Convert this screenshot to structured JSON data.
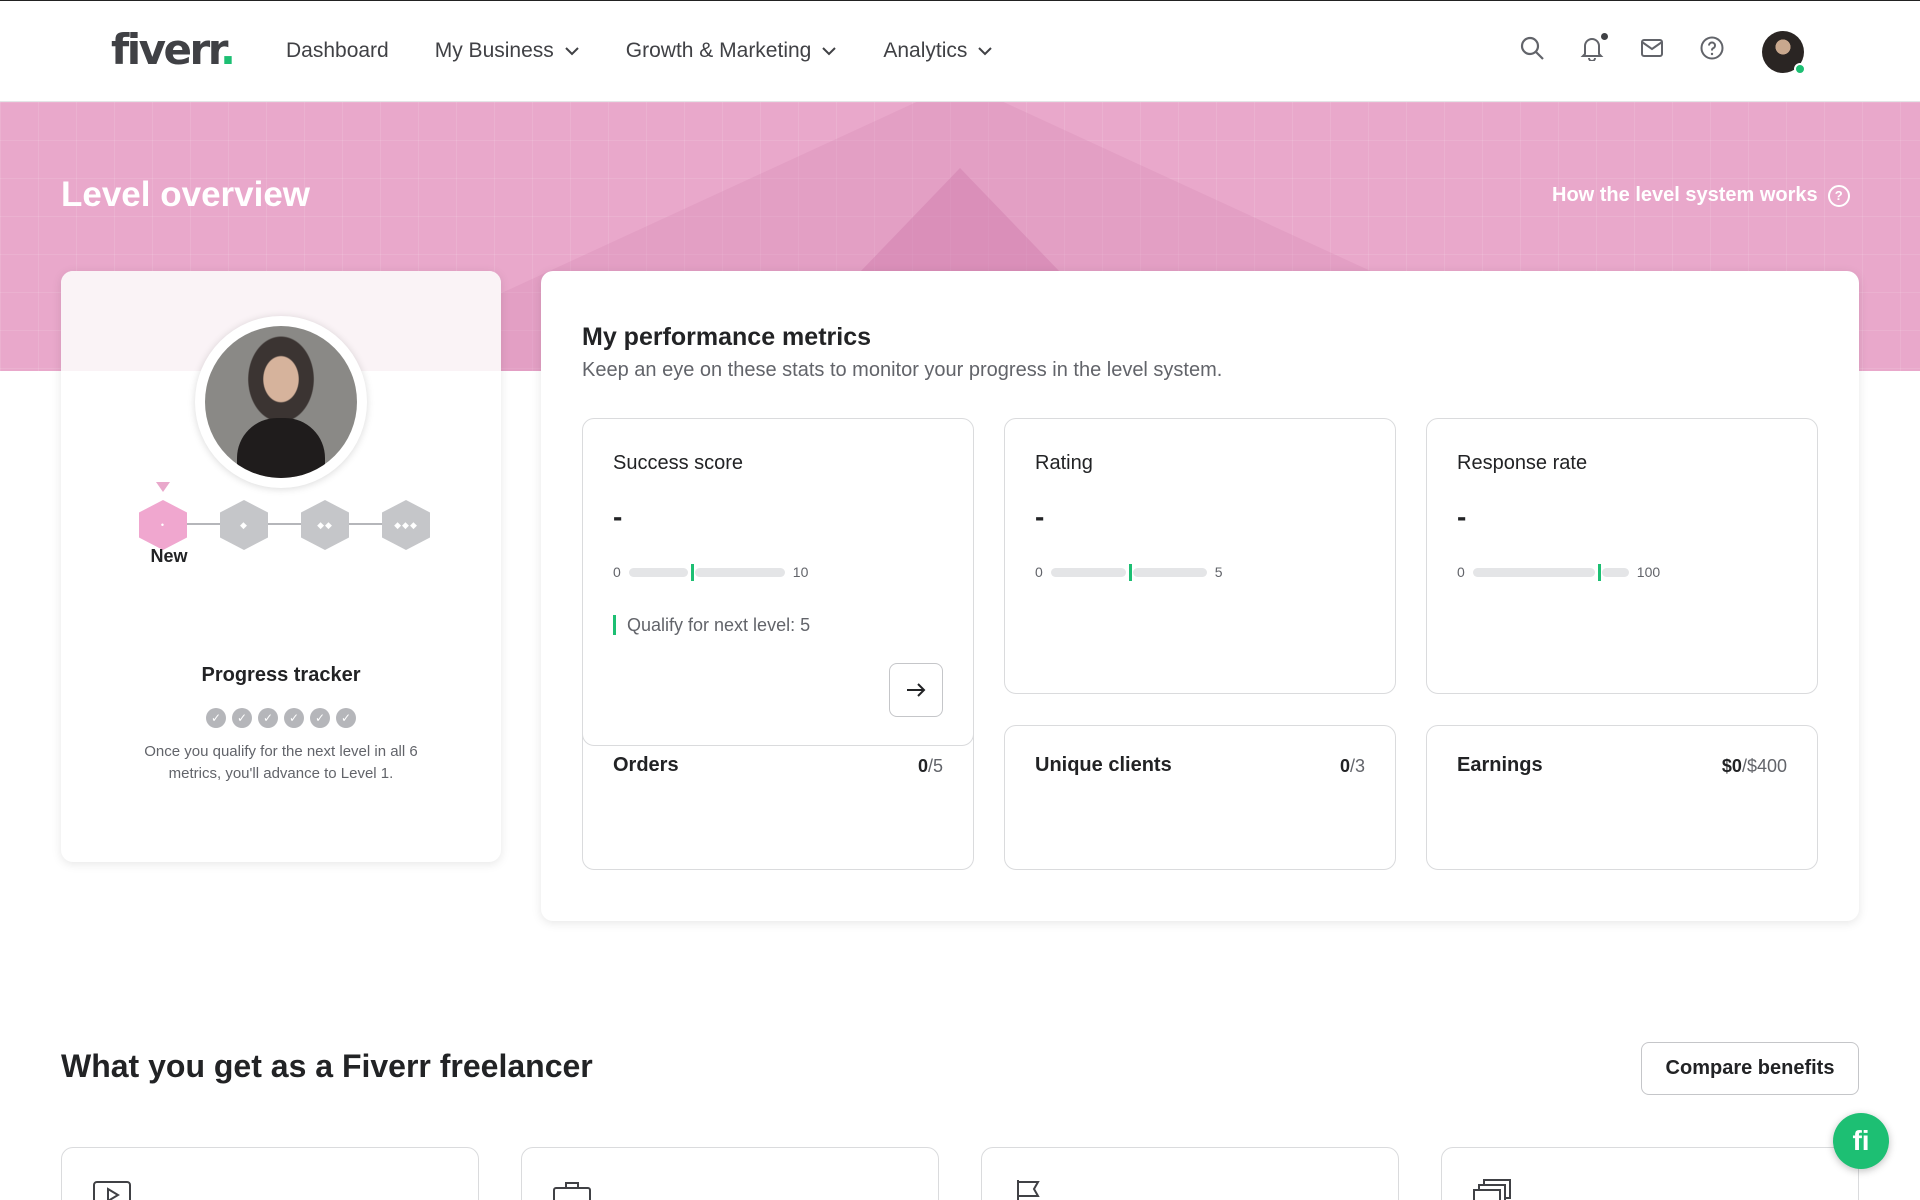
{
  "header": {
    "logo": "fiverr",
    "logo_dot": ".",
    "nav": [
      {
        "label": "Dashboard",
        "dropdown": false
      },
      {
        "label": "My Business",
        "dropdown": true
      },
      {
        "label": "Growth & Marketing",
        "dropdown": true
      },
      {
        "label": "Analytics",
        "dropdown": true
      }
    ],
    "icons": [
      "search-icon",
      "bell-icon",
      "mail-icon",
      "help-icon"
    ]
  },
  "banner": {
    "title": "Level overview",
    "help_link": "How the level system works",
    "help_icon": "?"
  },
  "level_card": {
    "levels": [
      {
        "name": "New",
        "stars": "•",
        "active": true
      },
      {
        "name": "",
        "stars": "◆",
        "active": false
      },
      {
        "name": "",
        "stars": "◆◆",
        "active": false
      },
      {
        "name": "",
        "stars": "◆◆◆",
        "active": false
      }
    ],
    "current_level": "New",
    "progress_title": "Progress tracker",
    "checks": 6,
    "progress_desc": "Once you qualify for the next level in all 6 metrics, you'll advance to Level 1."
  },
  "metrics": {
    "title": "My performance metrics",
    "subtitle": "Keep an eye on these stats to monitor your progress in the level system.",
    "cards": [
      {
        "label": "Success score",
        "value": "-",
        "min": "0",
        "max": "10",
        "threshold_fraction": 0.4,
        "qualify": "Qualify for next level: 5"
      },
      {
        "label": "Rating",
        "value": "-",
        "min": "0",
        "max": "5",
        "threshold_fraction": 0.5
      },
      {
        "label": "Response rate",
        "value": "-",
        "min": "0",
        "max": "100",
        "threshold_fraction": 0.8
      }
    ],
    "counts": [
      {
        "label": "Orders",
        "current": "0",
        "target": "/5"
      },
      {
        "label": "Unique clients",
        "current": "0",
        "target": "/3"
      },
      {
        "label": "Earnings",
        "current": "$0",
        "target": "/$400"
      }
    ]
  },
  "benefits": {
    "title": "What you get as a Fiverr freelancer",
    "compare_button": "Compare benefits",
    "card_icons": [
      "play-icon",
      "briefcase-icon",
      "flag-icon",
      "stack-icon"
    ]
  },
  "fab": {
    "label": "fi"
  },
  "colors": {
    "brand_green": "#1dbf73",
    "banner_pink": "#e9a8cb",
    "text_dark": "#222325"
  }
}
